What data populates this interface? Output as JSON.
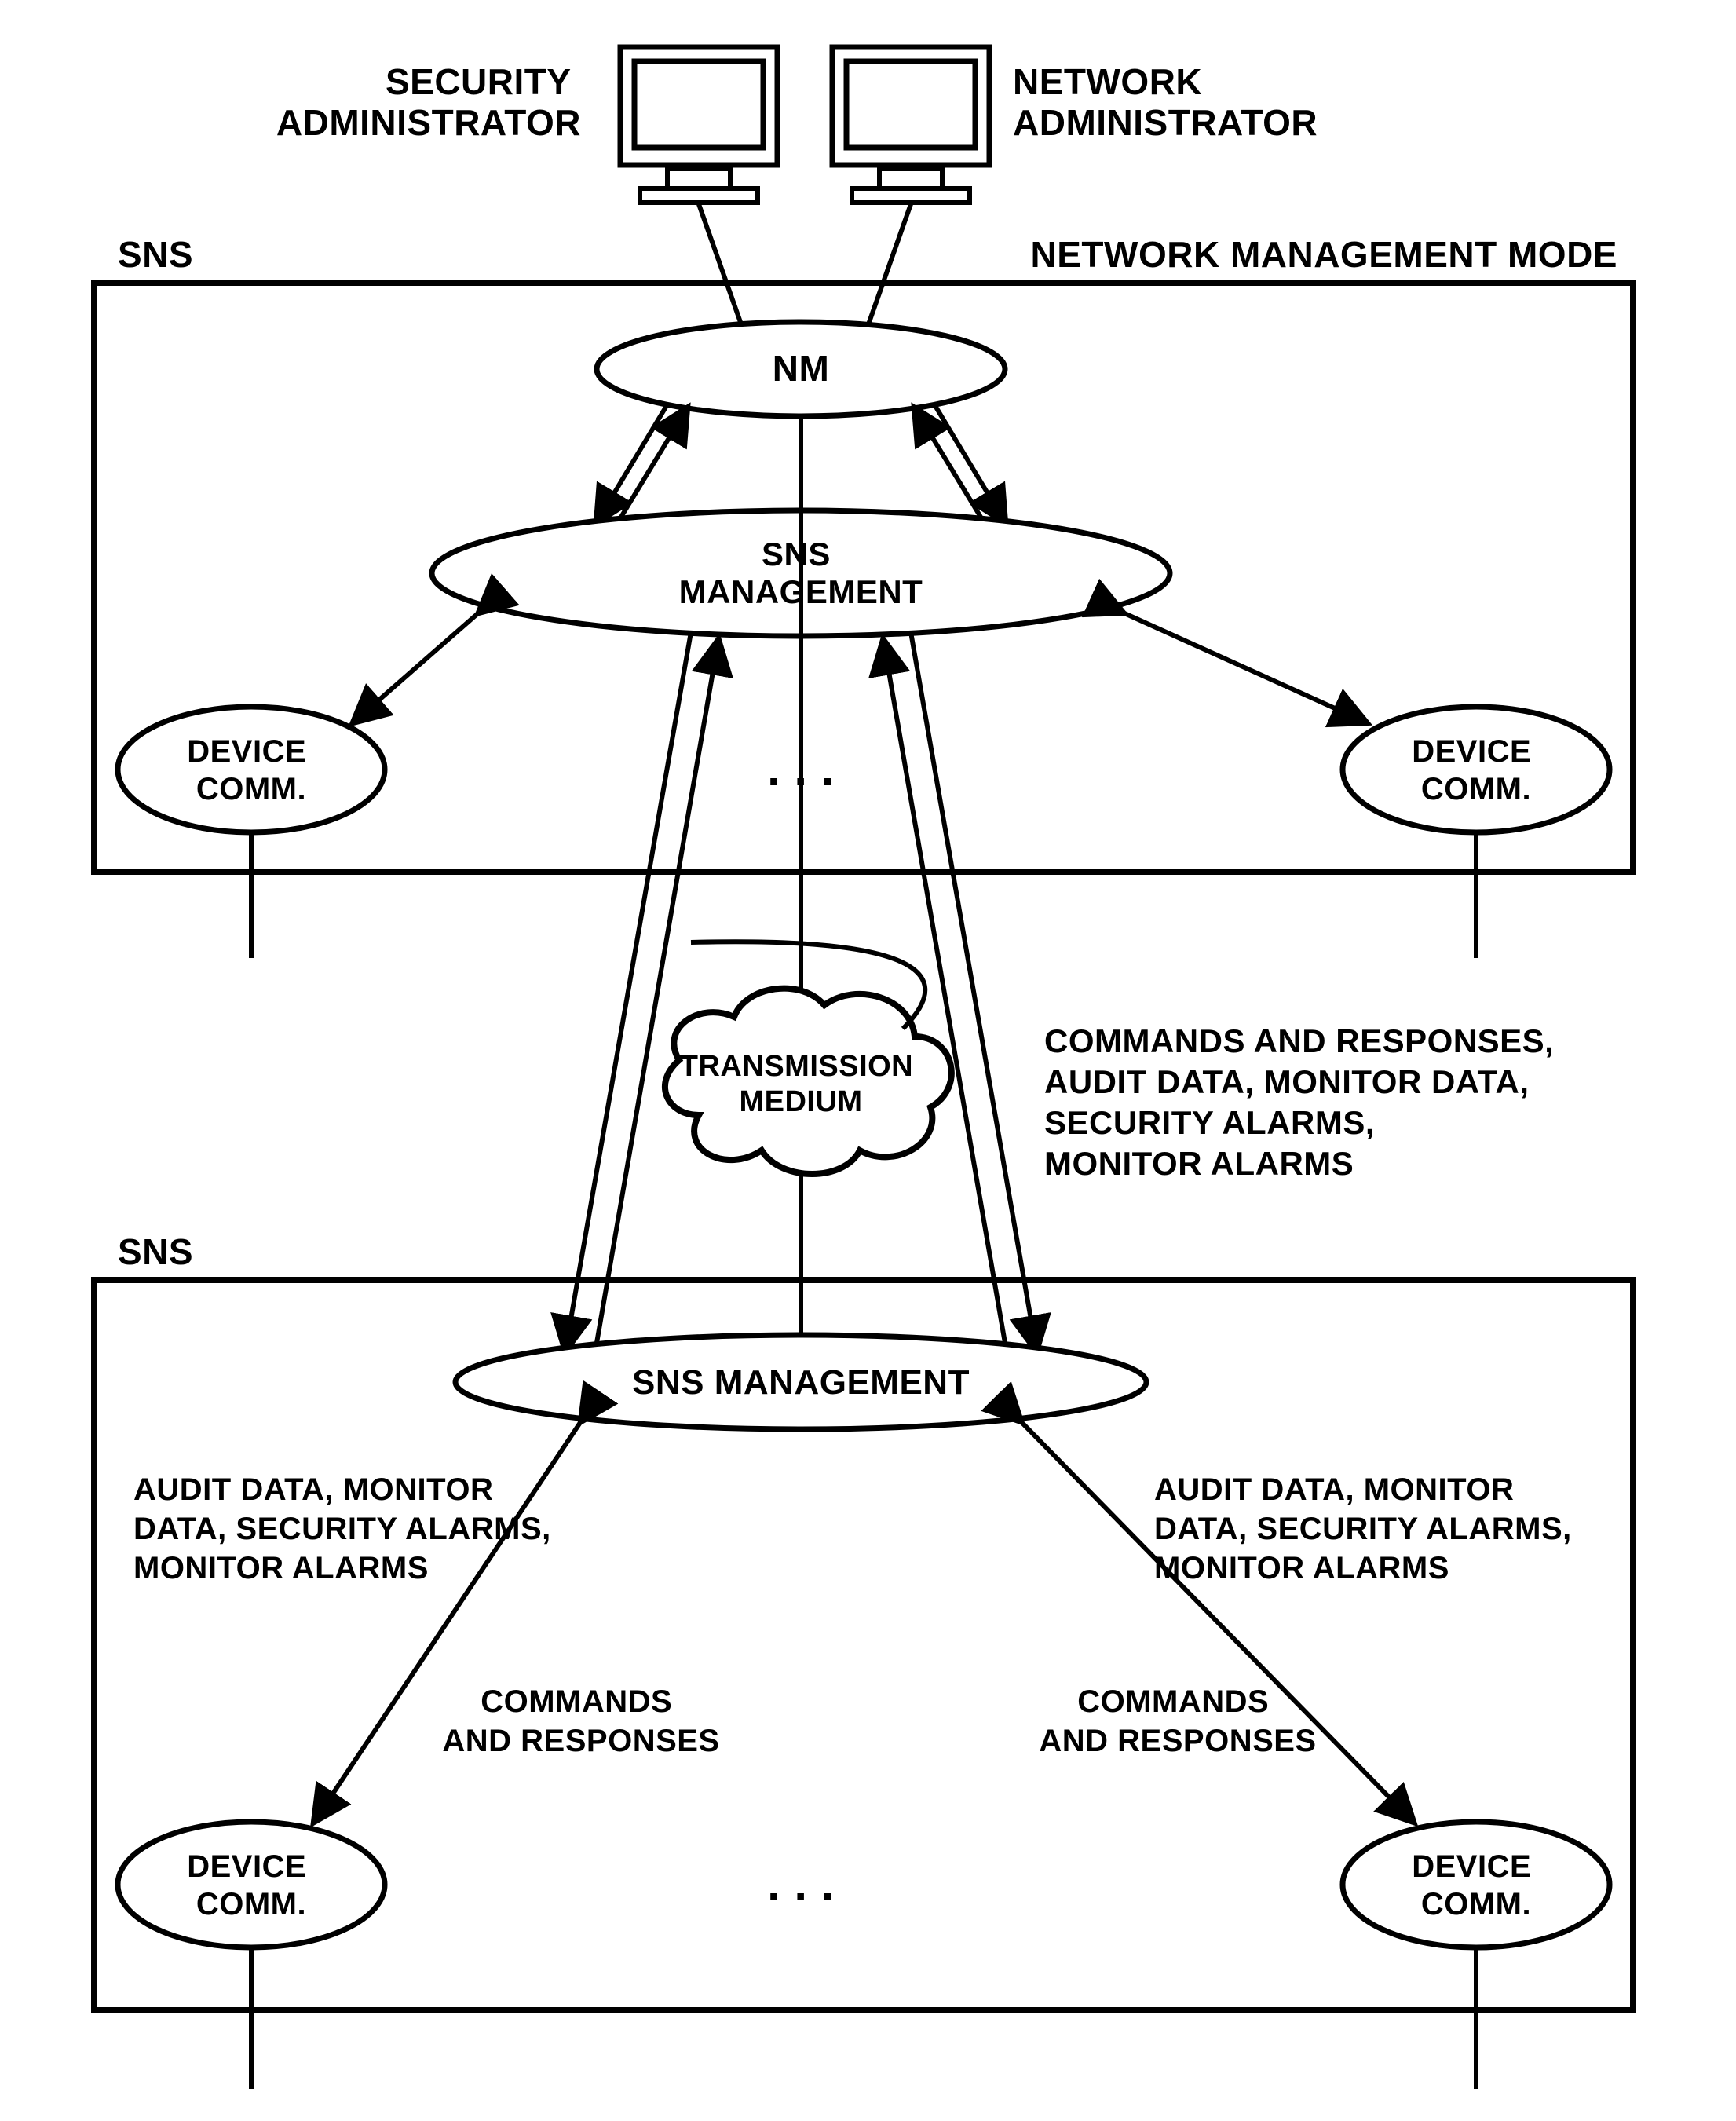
{
  "top": {
    "security_admin": "SECURITY\nADMINISTRATOR",
    "network_admin": "NETWORK\nADMINISTRATOR"
  },
  "upper_box": {
    "left_label": "SNS",
    "right_label": "NETWORK MANAGEMENT MODE",
    "nm": "NM",
    "sns_mgmt": "SNS\nMANAGEMENT",
    "device_left": "DEVICE\nCOMM.",
    "device_right": "DEVICE\nCOMM.",
    "ellipsis": ". . ."
  },
  "middle": {
    "cloud": "TRANSMISSION\nMEDIUM",
    "side_text": "COMMANDS AND RESPONSES,\nAUDIT DATA, MONITOR DATA,\nSECURITY ALARMS,\nMONITOR ALARMS"
  },
  "lower_box": {
    "left_label": "SNS",
    "sns_mgmt": "SNS MANAGEMENT",
    "audit_left": "AUDIT DATA, MONITOR\nDATA, SECURITY ALARMS,\nMONITOR ALARMS",
    "audit_right": "AUDIT DATA, MONITOR\nDATA, SECURITY ALARMS,\nMONITOR ALARMS",
    "cmd_left": "COMMANDS\nAND RESPONSES",
    "cmd_right": "COMMANDS\nAND RESPONSES",
    "device_left": "DEVICE\nCOMM.",
    "device_right": "DEVICE\nCOMM.",
    "ellipsis": ". . ."
  }
}
